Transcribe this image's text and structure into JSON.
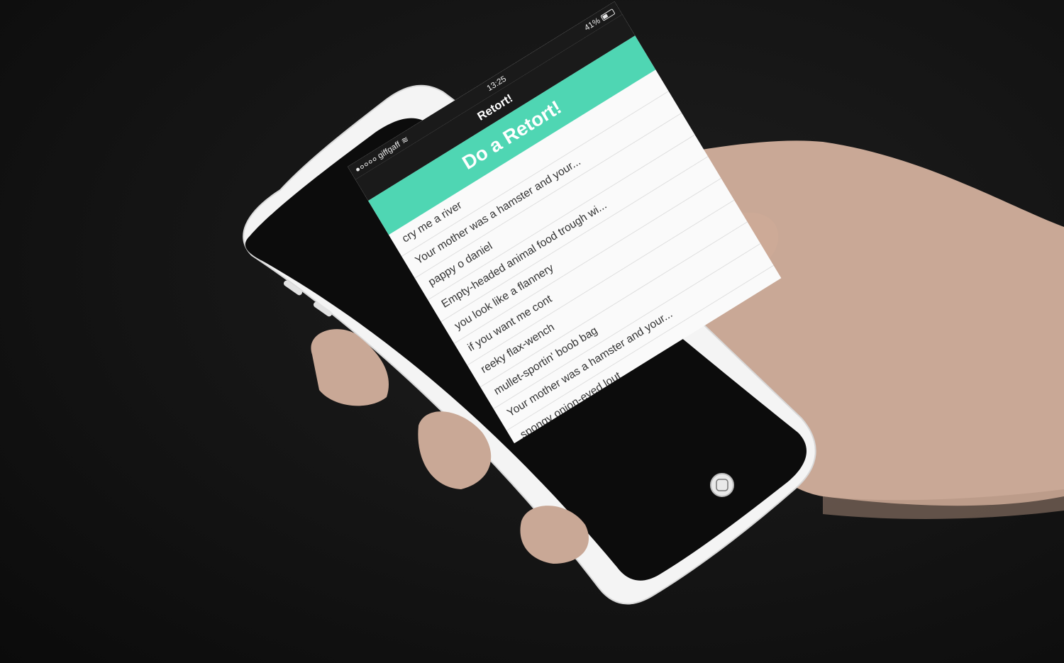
{
  "status_bar": {
    "carrier": "giffgaff",
    "time": "13:25",
    "battery": "41%"
  },
  "app": {
    "title": "Retort!",
    "cta_label": "Do a Retort!"
  },
  "retorts": [
    "cry me a river",
    "Your mother was a hamster and your...",
    "pappy o daniel",
    "Empty-headed animal food trough wi...",
    "you look like a flannery",
    "if you want me cont",
    "reeky flax-wench",
    "mullet-sportin' boob bag",
    "Your mother was a hamster and your...",
    "spongy onion-eyed lout"
  ],
  "colors": {
    "accent": "#4fd6b3",
    "header": "#1a1a1a",
    "background": "#111111",
    "phone_body": "#f4f4f4"
  }
}
